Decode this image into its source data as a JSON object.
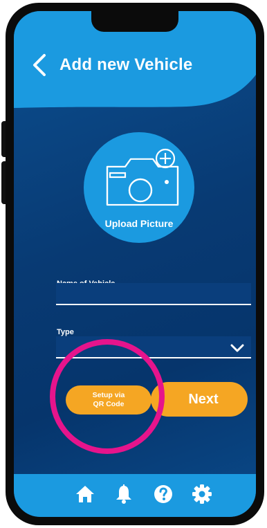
{
  "header": {
    "title": "Add new Vehicle",
    "back_icon": "chevron-left-icon"
  },
  "upload": {
    "label": "Upload Picture",
    "icon": "camera-add-icon"
  },
  "form": {
    "name_label": "Name of Vehicle",
    "name_value": "",
    "type_label": "Type",
    "type_value": ""
  },
  "actions": {
    "qr_line1": "Setup via",
    "qr_line2": "QR Code",
    "next_label": "Next"
  },
  "bottom_nav": {
    "items": [
      "home-icon",
      "bell-icon",
      "help-icon",
      "gear-icon"
    ]
  },
  "colors": {
    "accent_blue": "#1b9ae0",
    "background_navy": "#083a73",
    "button_orange": "#f5a623",
    "highlight_magenta": "#e6148c"
  }
}
